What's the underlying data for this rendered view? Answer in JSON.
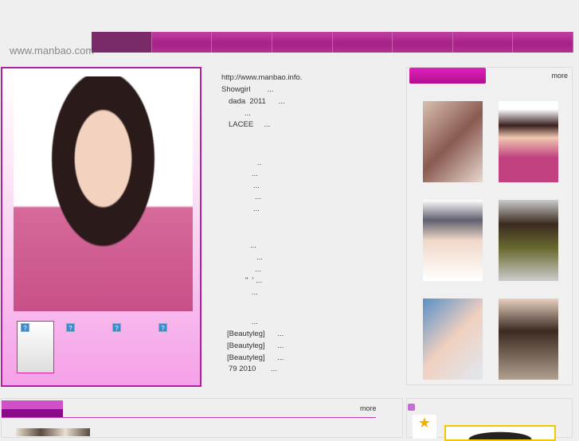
{
  "header": {
    "logo_text": "www.manbao.com",
    "nav_items": [
      "",
      "",
      "",
      "",
      "",
      "",
      "",
      "",
      ""
    ]
  },
  "feature": {
    "thumb_icons": [
      "?",
      "?",
      "?",
      "?"
    ]
  },
  "news": [
    {
      "text": "http://www.manbao.info.",
      "indent": 0
    },
    {
      "text": "Showgirl        ...",
      "indent": 0
    },
    {
      "text": "dada  2011      ...",
      "indent": 9
    },
    {
      "text": "...",
      "indent": 29
    },
    {
      "text": "LACEE     ...",
      "indent": 9
    },
    {
      "text": "..",
      "indent": 45
    },
    {
      "text": "...",
      "indent": 38
    },
    {
      "text": "...",
      "indent": 40
    },
    {
      "text": "...",
      "indent": 42
    },
    {
      "text": "...",
      "indent": 40
    },
    {
      "text": "...",
      "indent": 36
    },
    {
      "text": "...",
      "indent": 44
    },
    {
      "text": "...",
      "indent": 42
    },
    {
      "text": "\"  ' ...",
      "indent": 30
    },
    {
      "text": "...",
      "indent": 38
    },
    {
      "text": "...",
      "indent": 38
    },
    {
      "text": "[Beautyleg]      ...",
      "indent": 7
    },
    {
      "text": "[Beautyleg]      ...",
      "indent": 7
    },
    {
      "text": "[Beautyleg]      ...",
      "indent": 7
    },
    {
      "text": "79 2010       ...",
      "indent": 9
    }
  ],
  "gallery": {
    "more_label": "more"
  },
  "bottom": {
    "more_label": "more"
  },
  "colors": {
    "accent": "#b020a0",
    "nav": "#a8208a"
  }
}
